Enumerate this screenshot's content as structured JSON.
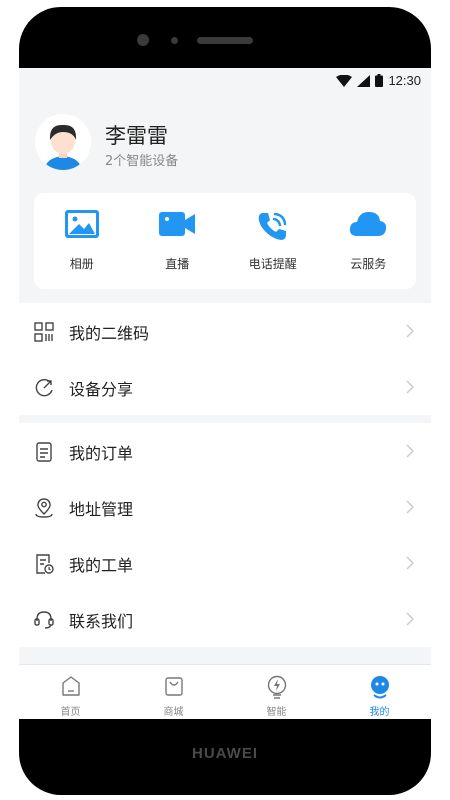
{
  "device": {
    "brand": "HUAWEI"
  },
  "status_bar": {
    "time": "12:30"
  },
  "profile": {
    "name": "李雷雷",
    "subtitle": "2个智能设备"
  },
  "quick_actions": [
    {
      "label": "相册",
      "icon": "photo-album-icon"
    },
    {
      "label": "直播",
      "icon": "video-camera-icon"
    },
    {
      "label": "电话提醒",
      "icon": "phone-ring-icon"
    },
    {
      "label": "云服务",
      "icon": "cloud-icon"
    }
  ],
  "menu_group_1": [
    {
      "label": "我的二维码",
      "icon": "qr-code-icon"
    },
    {
      "label": "设备分享",
      "icon": "share-icon"
    }
  ],
  "menu_group_2": [
    {
      "label": "我的订单",
      "icon": "order-icon"
    },
    {
      "label": "地址管理",
      "icon": "location-pin-icon"
    },
    {
      "label": "我的工单",
      "icon": "work-order-icon"
    },
    {
      "label": "联系我们",
      "icon": "headset-icon"
    }
  ],
  "tab_bar": [
    {
      "label": "首页",
      "icon": "home-icon"
    },
    {
      "label": "商城",
      "icon": "shop-icon"
    },
    {
      "label": "智能",
      "icon": "smart-bulb-icon"
    },
    {
      "label": "我的",
      "icon": "profile-face-icon",
      "active": true
    }
  ],
  "colors": {
    "accent": "#1e88e5",
    "icon_blue": "#2196f3",
    "background": "#f4f5f7"
  }
}
